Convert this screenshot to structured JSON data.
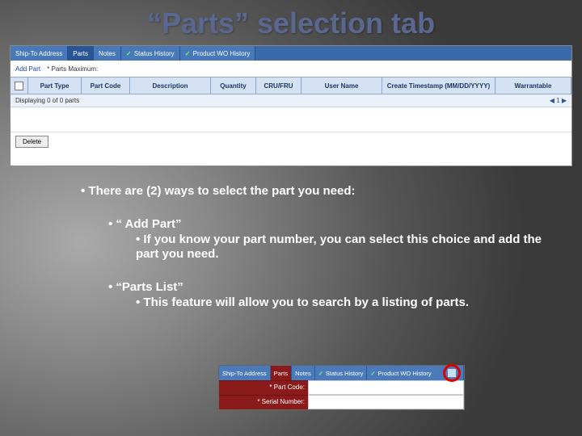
{
  "title": "“Parts” selection tab",
  "shot1": {
    "tabs": [
      "Ship-To Address",
      "Parts",
      "Notes",
      "Status History",
      "Product WO History"
    ],
    "active_tab_index": 1,
    "toolbar": {
      "addpart": "Add Part",
      "partsmax": "* Parts Maximum:"
    },
    "columns": [
      "Part Type",
      "Part Code",
      "Description",
      "Quantity",
      "CRU/FRU",
      "User Name",
      "Create Timestamp (MM/DD/YYYY)",
      "Warrantable"
    ],
    "status": "Displaying 0 of 0 parts",
    "pager": "◀ 1 ▶",
    "delete_label": "Delete"
  },
  "body": {
    "line0": "There are (2) ways to select the part you need:",
    "opt1_title": "“ Add Part”",
    "opt1_detail": "If you know your part number, you can select this choice and add the part you need.",
    "opt2_title": "“Parts List”",
    "opt2_detail": "This feature will allow you to search  by a listing of parts."
  },
  "shot2": {
    "tabs": [
      "Ship-To Address",
      "Parts",
      "Notes",
      "Status History",
      "Product WO History"
    ],
    "active_tab_index": 1,
    "field1": "* Part Code:",
    "field2": "* Serial Number:"
  }
}
